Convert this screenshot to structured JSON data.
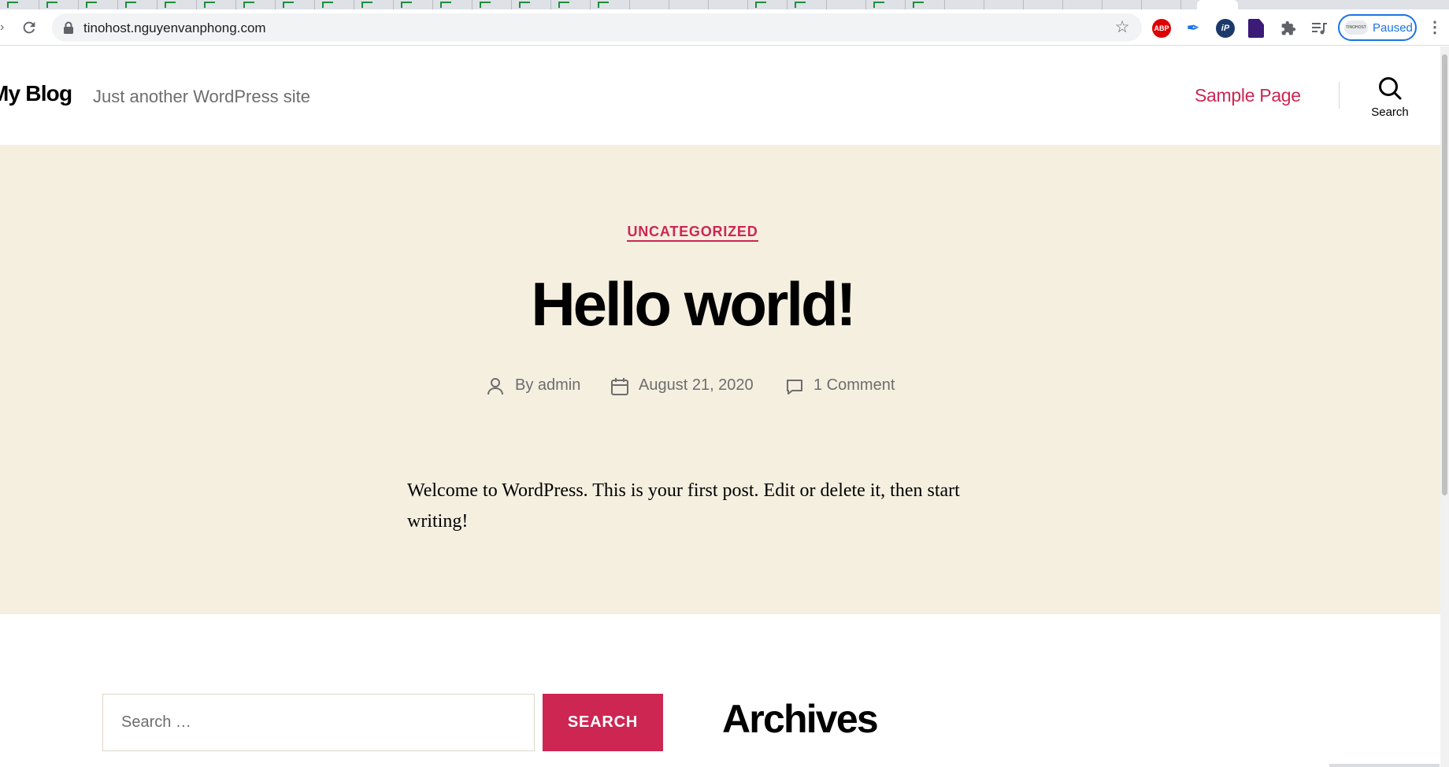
{
  "browser": {
    "url": "tinohost.nguyenvanphong.com",
    "profile_status": "Paused",
    "profile_avatar_text": "TINOHOST",
    "extension_abp_label": "ABP",
    "extension_ip_label": "iP",
    "accent_color": "#1a73e8"
  },
  "site": {
    "title": "My Blog",
    "description": "Just another WordPress site",
    "menu": [
      "Sample Page"
    ],
    "search_toggle_label": "Search",
    "accent_color": "#cd2653",
    "hero_background": "#f5efe0"
  },
  "post": {
    "category": "UNCATEGORIZED",
    "title": "Hello world!",
    "author": "By admin",
    "date": "August 21, 2020",
    "comments": "1 Comment",
    "body": "Welcome to WordPress. This is your first post. Edit or delete it, then start writing!"
  },
  "widgets": {
    "search_placeholder": "Search …",
    "search_button": "SEARCH",
    "archives_title": "Archives"
  }
}
